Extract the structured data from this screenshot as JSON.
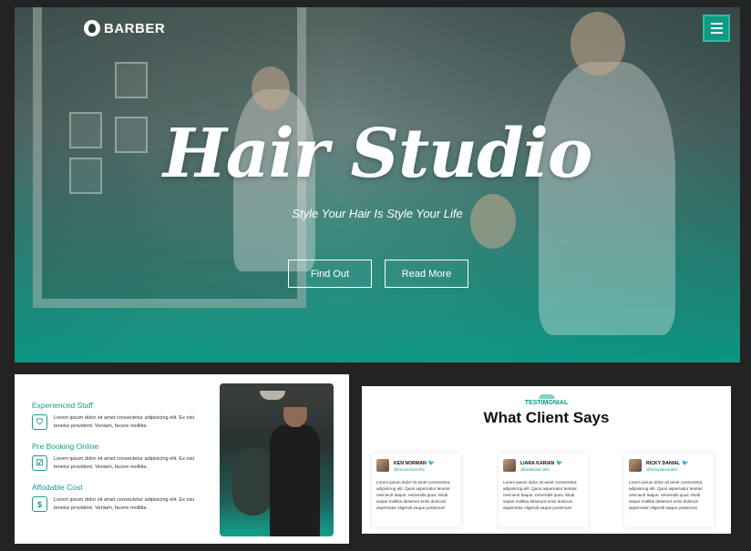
{
  "header": {
    "logo": "BARBER",
    "menu_icon": "hamburger-icon"
  },
  "hero": {
    "title": "Hair Studio",
    "subtitle": "Style Your Hair Is Style Your Life",
    "buttons": {
      "find": "Find Out",
      "read": "Read More"
    }
  },
  "features": [
    {
      "title": "Experienced Staff",
      "icon": "shield-icon",
      "glyph": "⛉",
      "text": "Lorem ipsum dolor sit amet consectetur adipisicing elit. Ex nisi tenetur provident. Veniam, facere mollitia."
    },
    {
      "title": "Pre Booking Online",
      "icon": "calendar-check-icon",
      "glyph": "☑",
      "text": "Lorem ipsum dolor sit amet consectetur adipisicing elit. Ex nisi tenetur provident. Veniam, facere mollitia."
    },
    {
      "title": "Affodable Cost",
      "icon": "dollar-icon",
      "glyph": "$",
      "text": "Lorem ipsum dolor sit amet consectetur adipisicing elit. Ex nisi tenetur provident. Veniam, facere mollitia."
    }
  ],
  "testimonial": {
    "tag": "TESTIMONIAL",
    "title": "What Client Says",
    "cards": [
      {
        "name": "KEN NORMAN",
        "handle": "@Kennorman.001",
        "text": "Lorem ipsum dolor sit amet consectetur, adipisicing elit. Quos aspernatur tenetur nesciunt! Itaque, reiciendis quos. Modi saepe mollitia deserunt enim dolorum aspernatur eligendi eaque possimus!"
      },
      {
        "name": "LIARA KARIAN",
        "handle": "@liarakarian.002",
        "text": "Lorem ipsum dolor sit amet consectetur, adipisicing elit. Quos aspernatur tenetur nesciunt! Itaque, reiciendis quos. Modi saepe mollitia deserunt enim dolorum aspernatur eligendi eaque possimus!"
      },
      {
        "name": "RICKY DANIAL",
        "handle": "@Rickydanial.003",
        "text": "Lorem ipsum dolor sit amet consectetur, adipisicing elit. Quos aspernatur tenetur nesciunt! Itaque, reiciendis quos. Modi saepe mollitia deserunt enim dolorum aspernatur eligendi eaque possimus!"
      }
    ]
  },
  "colors": {
    "accent": "#0e9a85",
    "twitter": "#1da1f2"
  }
}
